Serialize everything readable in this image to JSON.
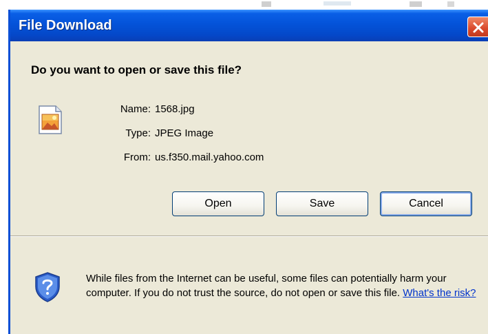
{
  "window": {
    "title": "File Download"
  },
  "dialog": {
    "question": "Do you want to open or save this file?",
    "file": {
      "name_label": "Name:",
      "name_value": "1568.jpg",
      "type_label": "Type:",
      "type_value": "JPEG Image",
      "from_label": "From:",
      "from_value": "us.f350.mail.yahoo.com"
    },
    "buttons": {
      "open": "Open",
      "save": "Save",
      "cancel": "Cancel"
    },
    "warning": {
      "text": "While files from the Internet can be useful, some files can potentially harm your computer. If you do not trust the source, do not open or save this file.",
      "link": "What's the risk?"
    }
  },
  "icons": {
    "file": "image-file-icon",
    "shield": "security-shield-icon",
    "close": "close-icon"
  },
  "colors": {
    "titlebar": "#0453d9",
    "dialog_bg": "#ece9d8",
    "close_button": "#d9482b",
    "link": "#0033cc"
  }
}
